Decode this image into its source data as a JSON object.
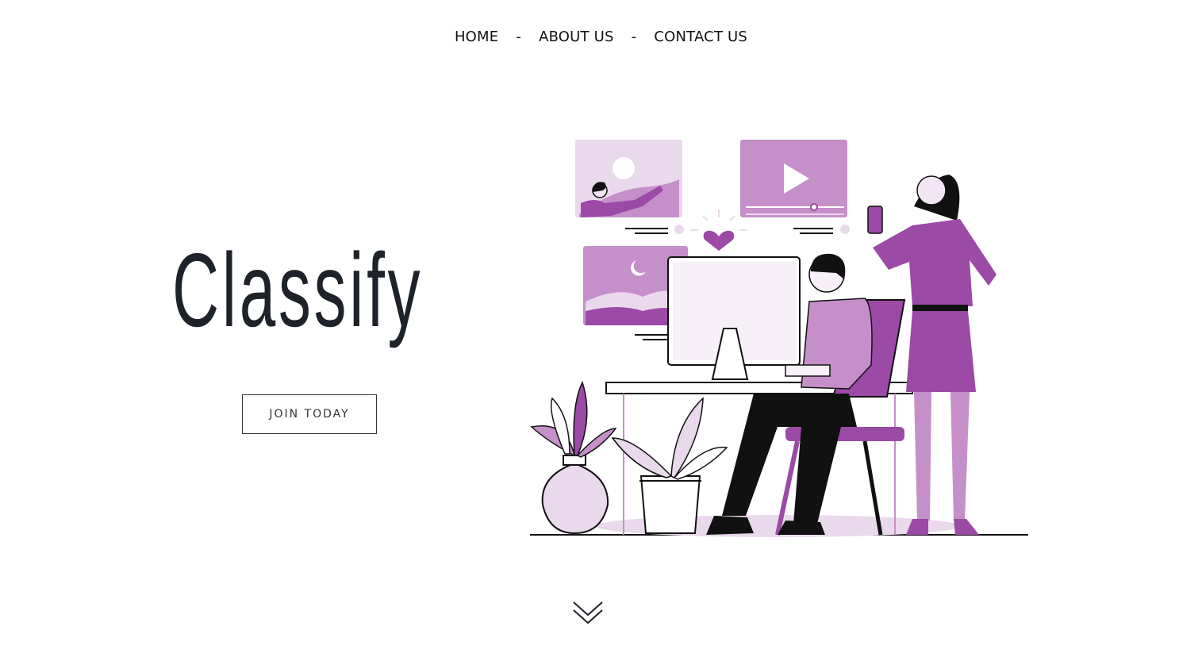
{
  "nav": {
    "home": "HOME",
    "separator": "-",
    "about": "ABOUT US",
    "contact": "CONTACT US"
  },
  "hero": {
    "brand": "Classify",
    "cta_label": "JOIN TODAY"
  },
  "icons": {
    "scroll": "chevron-down-icon"
  },
  "colors": {
    "accent": "#9b4aa6",
    "accent_light": "#c58fca",
    "accent_pale": "#ead8ec",
    "text": "#1e2229"
  }
}
